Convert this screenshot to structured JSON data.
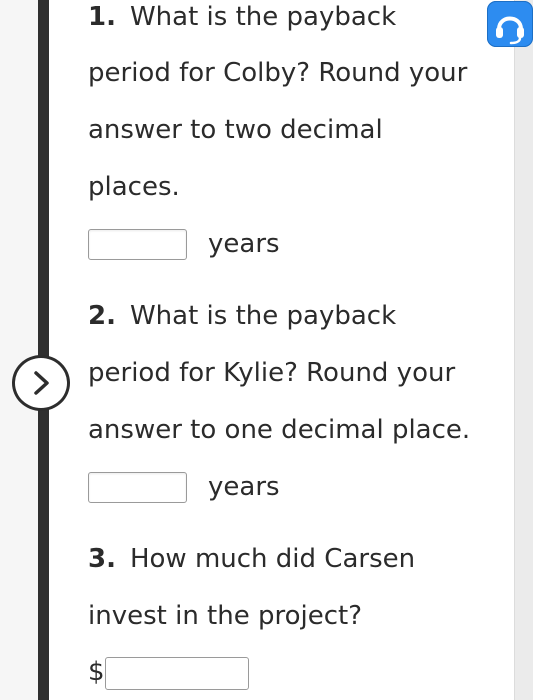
{
  "questions": [
    {
      "number": "1.",
      "lines": [
        "What is the payback",
        "period for Colby? Round your",
        "answer to two decimal",
        "places."
      ],
      "unit": "years"
    },
    {
      "number": "2.",
      "lines": [
        "What is the payback",
        "period for Kylie? Round your",
        "answer to one decimal place."
      ],
      "unit": "years"
    },
    {
      "number": "3.",
      "lines": [
        "How much did Carsen",
        "invest in the project?"
      ],
      "prefix": "$"
    }
  ],
  "icons": {
    "help": "headset-icon",
    "expand": "chevron-right-icon"
  },
  "colors": {
    "accent": "#2d8cf0",
    "sidebar_bar": "#2f2f2f",
    "text": "#2b2b2b"
  }
}
